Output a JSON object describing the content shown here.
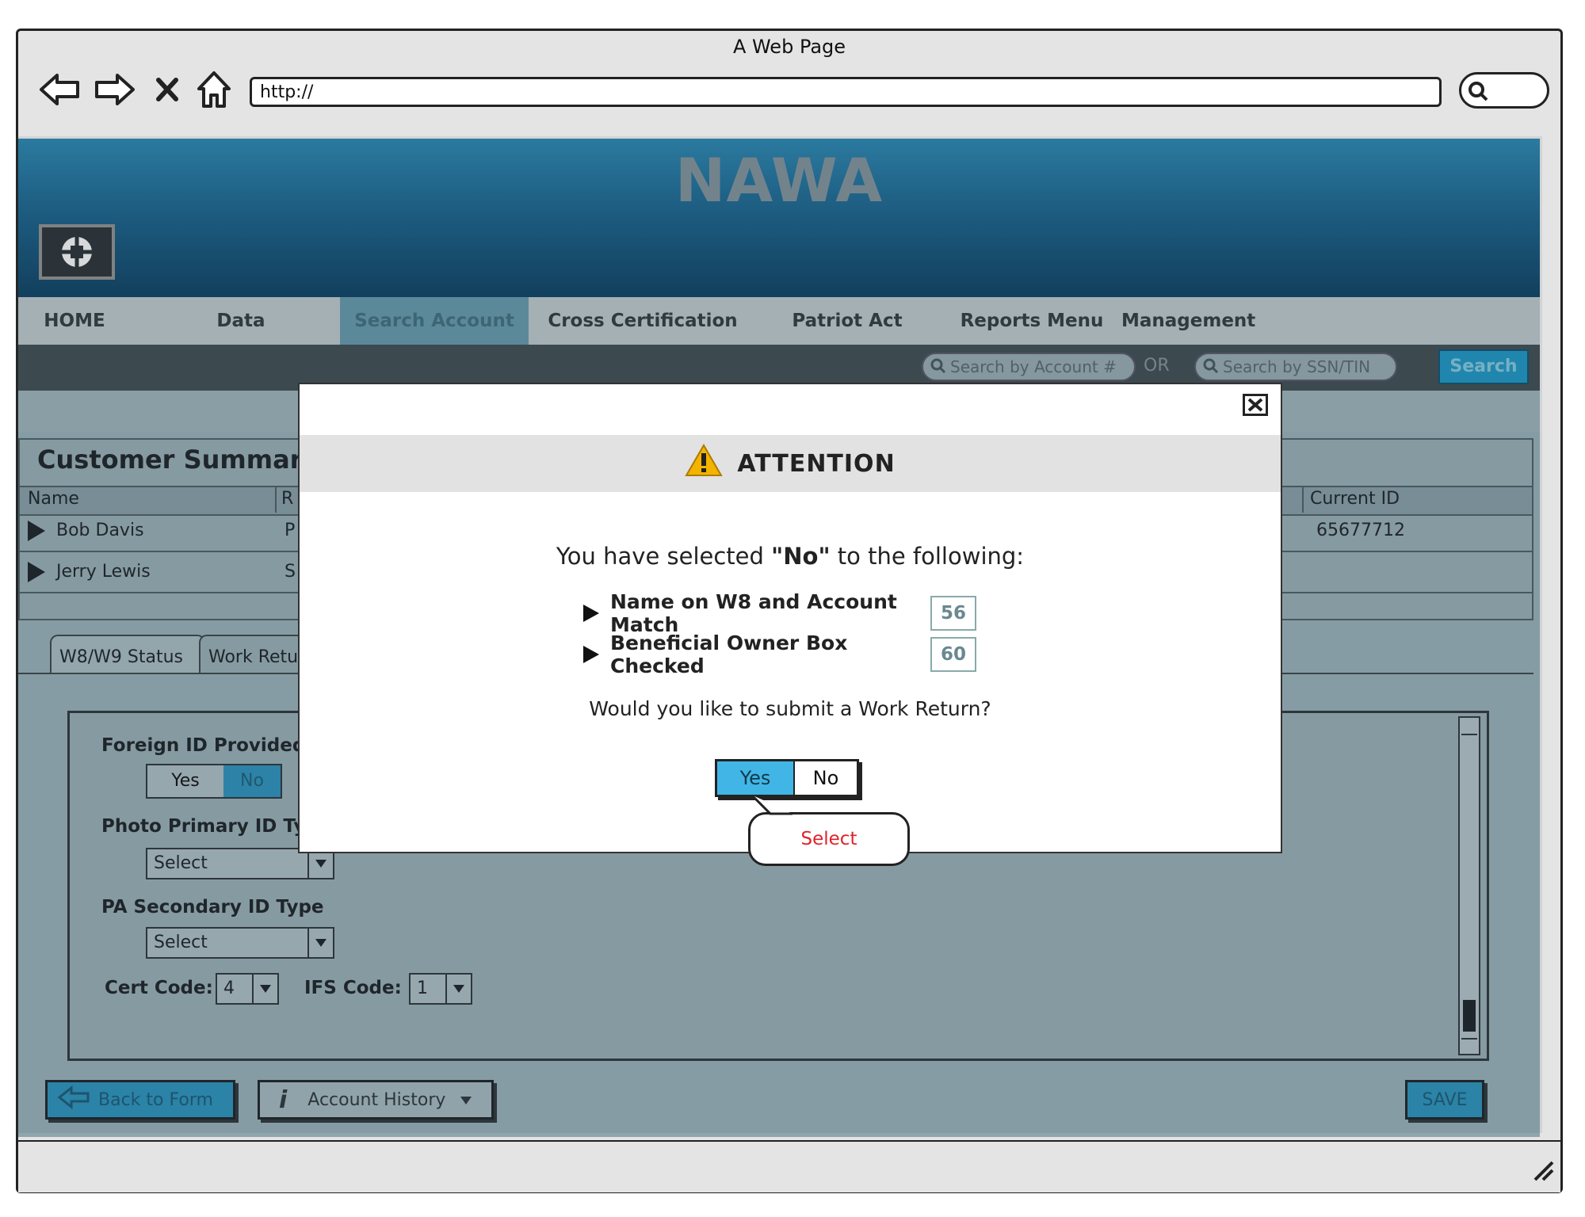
{
  "browser": {
    "title": "A Web Page",
    "url": "http://",
    "icons": [
      "back-arrow-icon",
      "forward-arrow-icon",
      "stop-icon",
      "home-icon",
      "search-icon"
    ]
  },
  "app": {
    "brand": "NAWA",
    "nav": [
      "HOME",
      "Data Management",
      "Search Account",
      "Cross Certification",
      "Patriot Act Review",
      "Reports Menu",
      "Management"
    ],
    "active_nav": "Search Account",
    "search": {
      "account_placeholder": "Search by Account #",
      "or_label": "OR",
      "ssn_placeholder": "Search by SSN/TIN",
      "button": "Search"
    }
  },
  "summary": {
    "title": "Customer Summary:",
    "columns": [
      "Name",
      "R",
      "Current ID"
    ],
    "rows": [
      {
        "name": "Bob Davis",
        "r": "P",
        "current_id": "65677712"
      },
      {
        "name": "Jerry Lewis",
        "r": "S",
        "current_id": ""
      }
    ]
  },
  "tabs": [
    "W8/W9 Status",
    "Work Retu"
  ],
  "form": {
    "foreign_id_label": "Foreign ID Provided",
    "toggle_yes": "Yes",
    "toggle_no": "No",
    "photo_id_label": "Photo Primary ID Ty",
    "photo_id_value": "Select",
    "pa_secondary_label": "PA Secondary ID Type",
    "pa_secondary_value": "Select",
    "cert_code_label": "Cert Code:",
    "cert_code_value": "4",
    "ifs_code_label": "IFS Code:",
    "ifs_code_value": "1"
  },
  "buttons": {
    "back": "Back to Form",
    "history": "Account History",
    "save": "SAVE"
  },
  "modal": {
    "title": "ATTENTION",
    "message_prefix": "You have selected ",
    "message_bold": "\"No\"",
    "message_suffix": " to the following:",
    "items": [
      {
        "label": "Name on W8 and Account Match",
        "value": "56"
      },
      {
        "label": "Beneficial Owner Box Checked",
        "value": "60"
      }
    ],
    "question": "Would you like to submit a Work Return?",
    "yes": "Yes",
    "no": "No",
    "callout": "Select"
  },
  "colors": {
    "accent": "#41b6e6",
    "callout_text": "#e0222a",
    "header_blue": "#1a5f86"
  }
}
